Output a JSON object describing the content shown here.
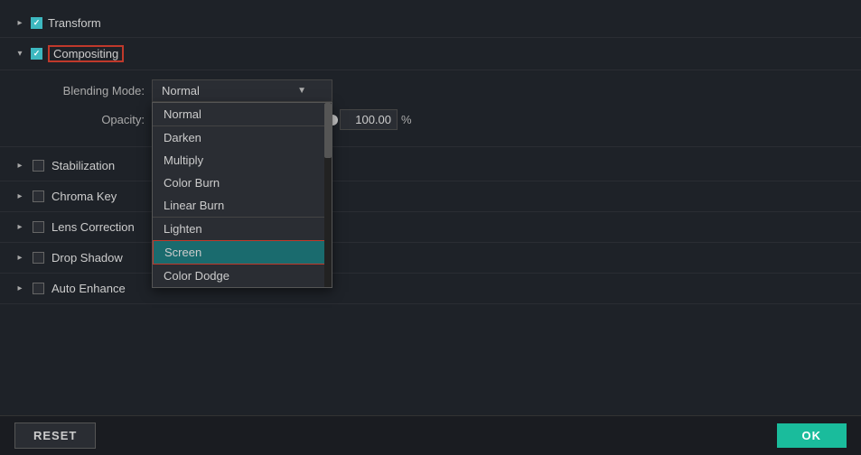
{
  "sidebar": {
    "transform_label": "Transform",
    "compositing_label": "Compositing",
    "stabilization_label": "Stabilization",
    "chroma_key_label": "Chroma Key",
    "lens_correction_label": "Lens Correction",
    "drop_shadow_label": "Drop Shadow",
    "auto_enhance_label": "Auto Enhance"
  },
  "compositing": {
    "blending_mode_label": "Blending Mode:",
    "opacity_label": "Opacity:",
    "selected_blend": "Normal",
    "opacity_value": "100.00",
    "opacity_unit": "%"
  },
  "dropdown": {
    "items": [
      {
        "label": "Normal",
        "divider": true
      },
      {
        "label": "Darken"
      },
      {
        "label": "Multiply"
      },
      {
        "label": "Color Burn"
      },
      {
        "label": "Linear Burn",
        "divider": true
      },
      {
        "label": "Lighten"
      },
      {
        "label": "Screen",
        "highlighted": true
      },
      {
        "label": "Color Dodge"
      }
    ]
  },
  "buttons": {
    "reset": "RESET",
    "ok": "OK"
  }
}
